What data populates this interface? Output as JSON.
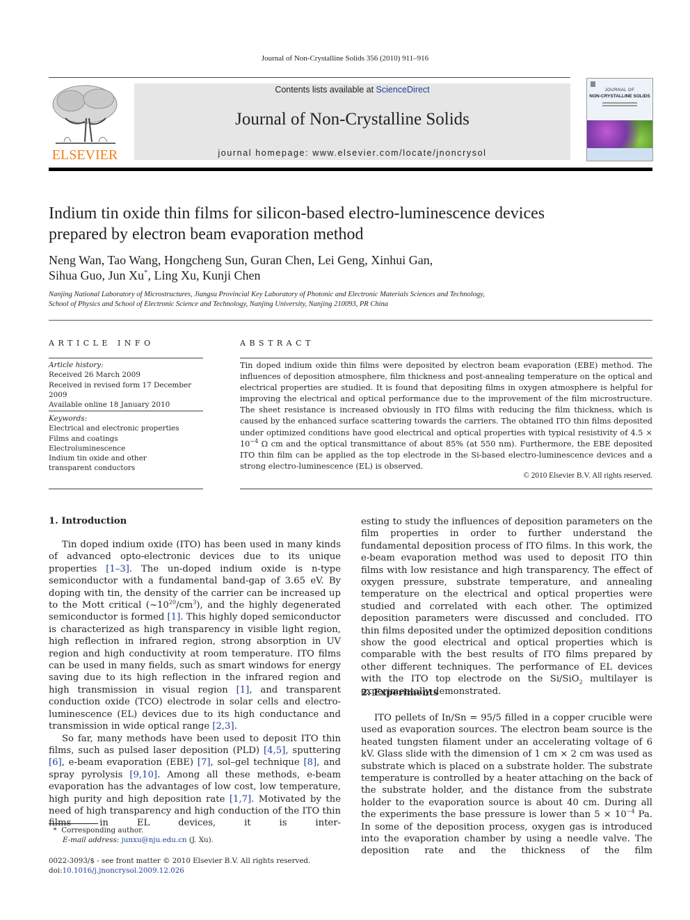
{
  "header": {
    "running_head": "Journal of Non-Crystalline Solids 356 (2010) 911–916",
    "contents_prefix": "Contents lists available at ",
    "sciencedirect_link": "ScienceDirect",
    "journal_name": "Journal of Non-Crystalline Solids",
    "homepage": "journal homepage: www.elsevier.com/locate/jnoncrysol",
    "publisher_wordmark": "ELSEVIER",
    "cover_line1": "JOURNAL OF",
    "cover_line2": "NON-CRYSTALLINE SOLIDS",
    "colors": {
      "elsevier_orange": "#f07f1a",
      "link_blue": "#1f3e9a",
      "header_gray": "#e6e6e6"
    }
  },
  "article": {
    "title_line1": "Indium tin oxide thin films for silicon-based electro-luminescence devices",
    "title_line2": "prepared by electron beam evaporation method",
    "authors_line1": "Neng Wan, Tao Wang, Hongcheng Sun, Guran Chen, Lei Geng, Xinhui Gan,",
    "authors_line2_a": "Sihua Guo, Jun Xu",
    "authors_line2_star": "*",
    "authors_line2_b": ", Ling Xu, Kunji Chen",
    "affiliation_line1": "Nanjing National Laboratory of Microstructures, Jiangsu Provincial Key Laboratory of Photonic and Electronic Materials Sciences and Technology,",
    "affiliation_line2": "School of Physics and School of Electronic Science and Technology, Nanjing University, Nanjing 210093, PR China"
  },
  "article_info": {
    "heading": "ARTICLE INFO",
    "history_label": "Article history:",
    "history": [
      "Received 26 March 2009",
      "Received in revised form 17 December 2009",
      "Available online 18 January 2010"
    ],
    "keywords_label": "Keywords:",
    "keywords": [
      "Electrical and electronic properties",
      "Films and coatings",
      "Electroluminescence",
      "Indium tin oxide and other transparent conductors"
    ]
  },
  "abstract": {
    "heading": "ABSTRACT",
    "text_a": "Tin doped indium oxide thin films were deposited by electron beam evaporation (EBE) method. The influences of deposition atmosphere, film thickness and post-annealing temperature on the optical and electrical properties are studied. It is found that depositing films in oxygen atmosphere is helpful for improving the electrical and optical performance due to the improvement of the film microstructure. The sheet resistance is increased obviously in ITO films with reducing the film thickness, which is caused by the enhanced surface scattering towards the carriers. The obtained ITO thin films deposited under optimized conditions have good electrical and optical properties with typical resistivity of 4.5 × 10",
    "text_sup": "−4",
    "text_b": " Ω cm and the optical transmittance of about 85% (at 550 nm). Furthermore, the EBE deposited ITO thin film can be applied as the top electrode in the Si-based electro-luminescence devices and a strong electro-luminescence (EL) is observed.",
    "copyright": "© 2010 Elsevier B.V. All rights reserved."
  },
  "sections": {
    "intro_heading": "1. Introduction",
    "intro_p1": {
      "t1": "Tin doped indium oxide (ITO) has been used in many kinds of advanced opto-electronic devices due to its unique properties ",
      "r1": "[1–3]",
      "t2": ". The un-doped indium oxide is n-type semiconductor with a fundamental band-gap of 3.65 eV. By doping with tin, the density of the carrier can be increased up to the Mott critical (~10",
      "sup1": "20",
      "t3": "/cm",
      "sup2": "3",
      "t4": "), and the highly degenerated semiconductor is formed ",
      "r2": "[1]",
      "t5": ". This highly doped semiconductor is characterized as high transparency in visible light region, high reflection in infrared region, strong absorption in UV region and high conductivity at room temperature. ITO films can be used in many fields, such as smart windows for energy saving due to its high reflection in the infrared region and high transmission in visual region ",
      "r3": "[1]",
      "t6": ", and transparent conduction oxide (TCO) electrode in solar cells and electro-luminescence (EL) devices due to its high conductance and transmission in wide optical range ",
      "r4": "[2,3]",
      "t7": "."
    },
    "intro_p2": {
      "t1": "So far, many methods have been used to deposit ITO thin films, such as pulsed laser deposition (PLD) ",
      "r1": "[4,5]",
      "t2": ", sputtering ",
      "r2": "[6]",
      "t3": ", e-beam evaporation (EBE) ",
      "r3": "[7]",
      "t4": ", sol–gel technique ",
      "r4": "[8]",
      "t5": ", and spray pyrolysis ",
      "r5": "[9,10]",
      "t6": ". Among all these methods, e-beam evaporation has the advantages of low cost, low temperature, high purity and high deposition rate ",
      "r6": "[1,7]",
      "t7": ". Motivated by the need of high transparency and high conduction of the ITO thin films in EL devices, it is interesting to study the influences of deposition parameters on the film properties in order to further understand the fundamental deposition process of ITO films. In this work, the e-beam evaporation method was used to deposit ITO thin films with low resistance and high transparency. The effect of oxygen pressure, substrate temperature, and annealing temperature on the electrical and optical properties were studied and correlated with each other. The optimized deposition parameters were discussed and concluded. ITO thin films deposited under the optimized deposition conditions show the good electrical and optical properties which is comparable with the best results of ITO films prepared by other different techniques. The performance of EL devices with the ITO top electrode on the Si/SiO",
      "sub1": "2",
      "t8": " multilayer is experimentally demonstrated."
    },
    "left_p2_visible": "So far, many methods have been used to deposit ITO thin films, such as pulsed laser deposition (PLD) [4,5], sputtering [6], e-beam evaporation (EBE) [7], sol–gel technique [8], and spray pyrolysis [9,10]. Among all these methods, e-beam evaporation has the advantages of low cost, low temperature, high purity and high deposition rate [1,7]. Motivated by the need of high transparency and high conduction of the ITO thin films in EL devices, it is inter-",
    "right_p_cont_a": "esting to study the influences of deposition parameters on the film properties in order to further understand the fundamental deposition process of ITO films. In this work, the e-beam evaporation method was used to deposit ITO thin films with low resistance and high transparency. The effect of oxygen pressure, substrate temperature, and annealing temperature on the electrical and optical properties were studied and correlated with each other. The optimized deposition parameters were discussed and concluded. ITO thin films deposited under the optimized deposition conditions show the good electrical and optical properties which is comparable with the best results of ITO films prepared by other different techniques. The performance of EL devices with the ITO top electrode on the Si/SiO",
    "right_p_cont_sub": "2",
    "right_p_cont_b": " multilayer is experimentally demonstrated.",
    "exp_heading": "2. Experiments",
    "exp_p1_a": "ITO pellets of In/Sn = 95/5 filled in a copper crucible were used as evaporation sources. The electron beam source is the heated tungsten filament under an accelerating voltage of 6 kV. Glass slide with the dimension of 1 cm × 2 cm was used as substrate which is placed on a substrate holder. The substrate temperature is controlled by a heater attaching on the back of the substrate holder, and the distance from the substrate holder to the evaporation source is about 40 cm. During all the experiments the base pressure is lower than 5 × 10",
    "exp_p1_sup": "−4",
    "exp_p1_b": " Pa. In some of the deposition process, oxygen gas is introduced into the evaporation chamber by using a needle valve. The deposition rate and the thickness of the film"
  },
  "footnote": {
    "star": "*",
    "corresponding": "Corresponding author.",
    "email_label": "E-mail address:",
    "email": "junxu@nju.edu.cn",
    "email_suffix": " (J. Xu).",
    "frontmatter": "0022-3093/$ - see front matter © 2010 Elsevier B.V. All rights reserved.",
    "doi_label": "doi:",
    "doi": "10.1016/j.jnoncrysol.2009.12.026"
  }
}
